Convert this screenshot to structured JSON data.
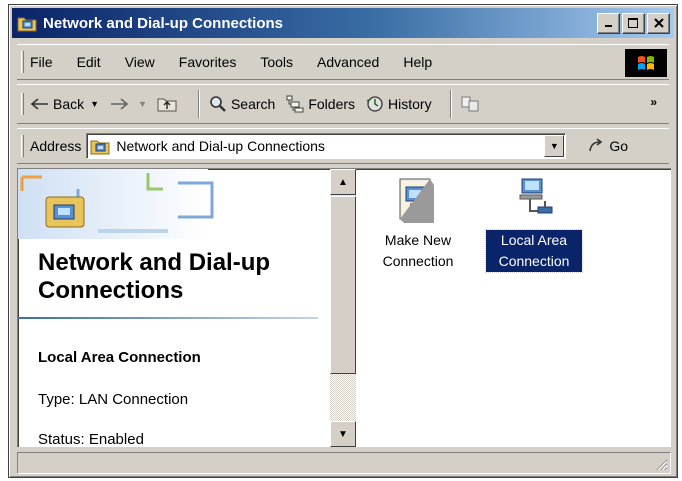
{
  "window": {
    "title": "Network and Dial-up Connections",
    "controls": {
      "minimize": "_",
      "maximize": "□",
      "close": "×"
    }
  },
  "menu": [
    "File",
    "Edit",
    "View",
    "Favorites",
    "Tools",
    "Advanced",
    "Help"
  ],
  "toolbar": {
    "back_label": "Back",
    "search_label": "Search",
    "folders_label": "Folders",
    "history_label": "History",
    "chevron": "»"
  },
  "address": {
    "label": "Address",
    "value": "Network and Dial-up Connections",
    "go_label": "Go"
  },
  "left_pane": {
    "title": "Network and Dial-up Connections",
    "selected_name": "Local Area Connection",
    "type_text": "Type: LAN Connection",
    "status_text": "Status: Enabled"
  },
  "items": [
    {
      "label": "Make New Connection",
      "icon": "make-new-connection-icon",
      "selected": false
    },
    {
      "label": "Local Area Connection",
      "icon": "lan-connection-icon",
      "selected": true
    }
  ],
  "colors": {
    "titlebar_start": "#0a246a",
    "titlebar_end": "#a6caf0",
    "selection": "#0a246a",
    "chrome": "#d4d0c8"
  }
}
